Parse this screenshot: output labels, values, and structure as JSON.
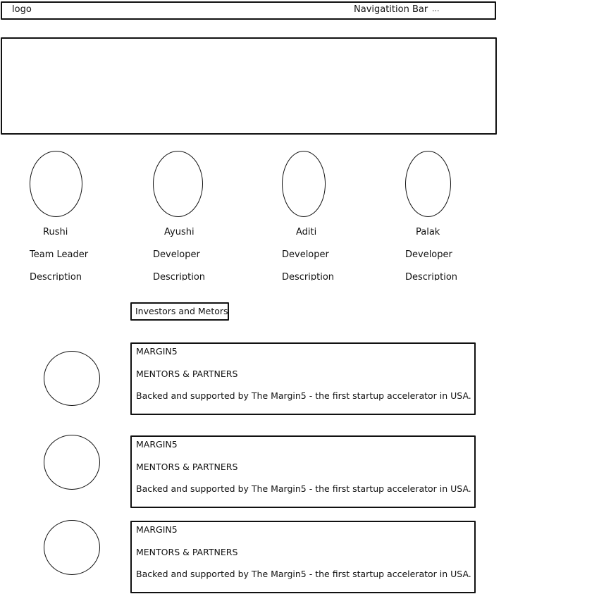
{
  "navbar": {
    "logo": "logo",
    "title": "Navigatition Bar",
    "more": "..."
  },
  "team": [
    {
      "name": "Rushi",
      "role": "Team Leader",
      "description": "Description"
    },
    {
      "name": "Ayushi",
      "role": "Developer",
      "description": "Description"
    },
    {
      "name": "Aditi",
      "role": "Developer",
      "description": "Description"
    },
    {
      "name": "Palak",
      "role": "Developer",
      "description": "Description"
    }
  ],
  "investors": {
    "heading": "Investors and Metors",
    "cards": [
      {
        "title": "MARGIN5",
        "subtitle": "MENTORS & PARTNERS",
        "text": "Backed and supported by The Margin5 - the first startup accelerator in USA."
      },
      {
        "title": "MARGIN5",
        "subtitle": "MENTORS & PARTNERS",
        "text": "Backed and supported by The Margin5 - the first startup accelerator in USA."
      },
      {
        "title": "MARGIN5",
        "subtitle": "MENTORS & PARTNERS",
        "text": "Backed and supported by The Margin5 - the first startup accelerator in USA."
      }
    ]
  }
}
